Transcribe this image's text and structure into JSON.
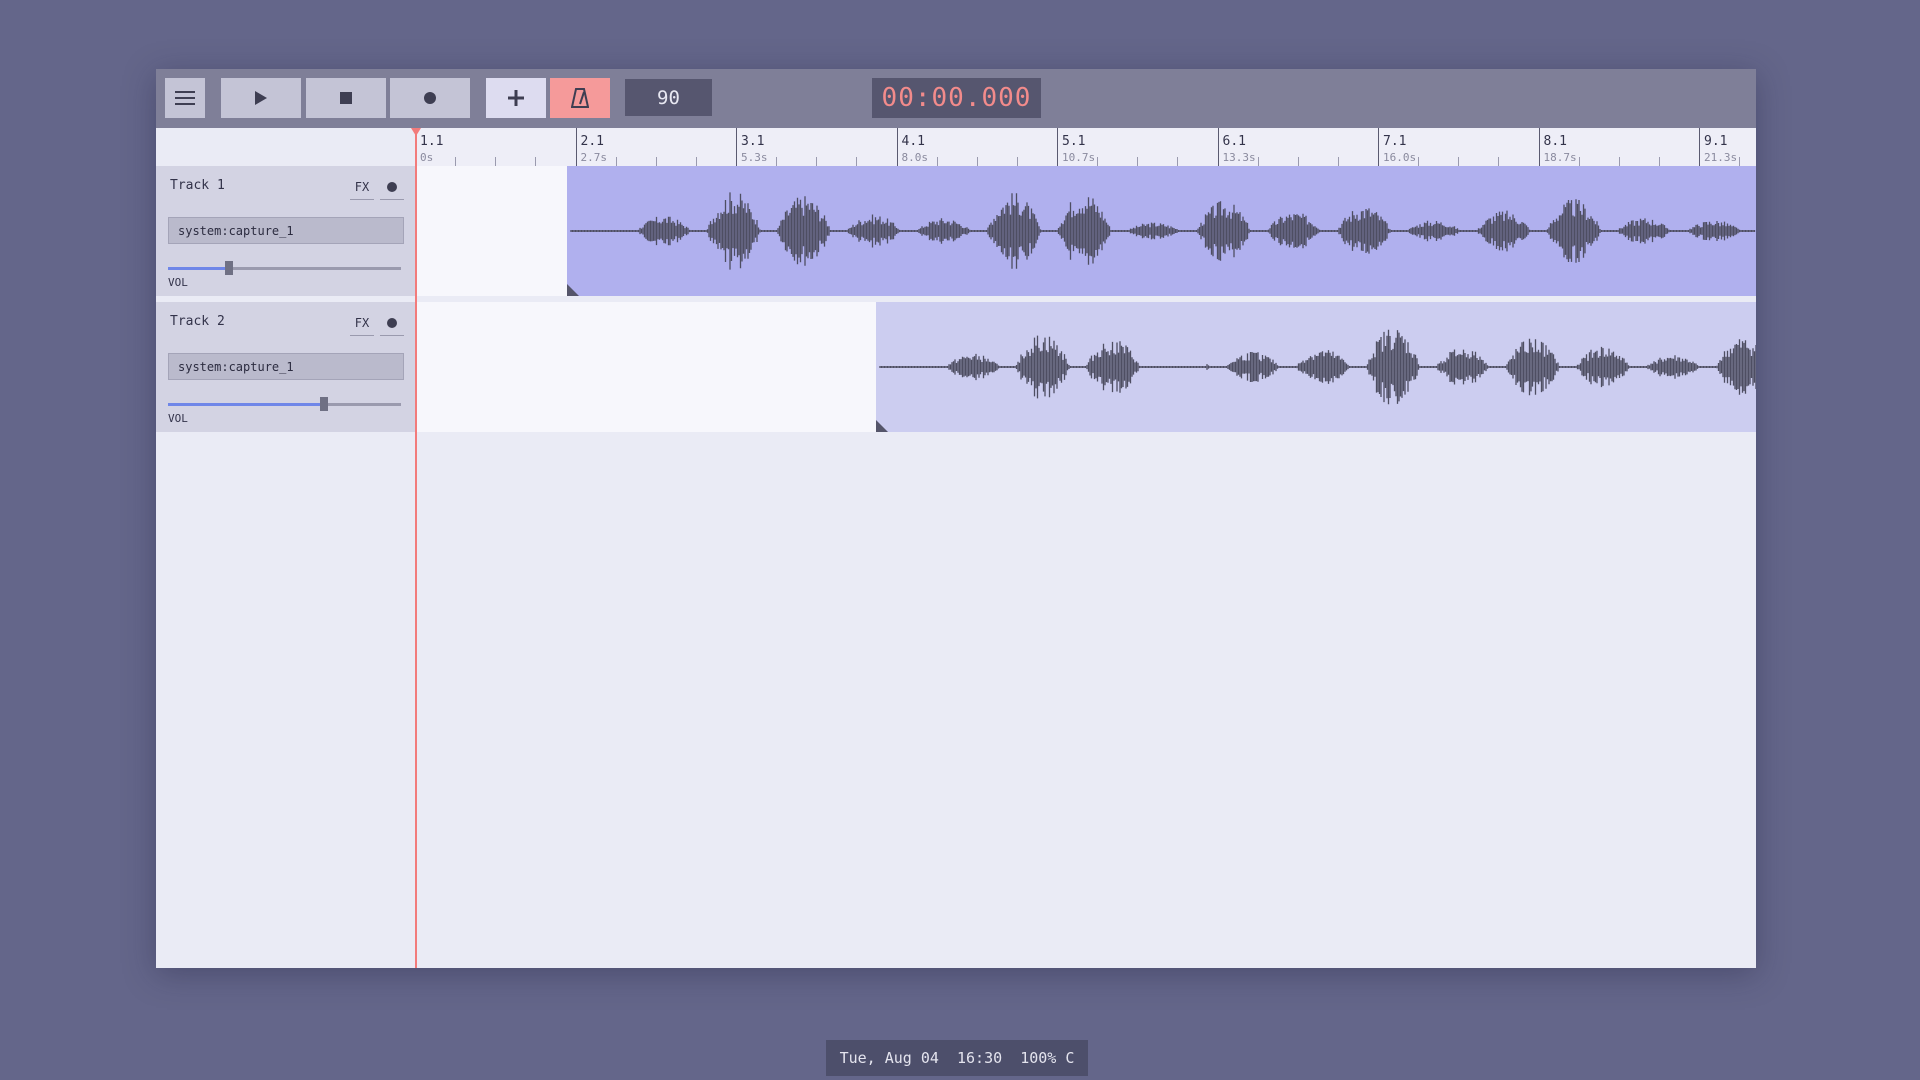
{
  "toolbar": {
    "menu_icon": "hamburger-menu-icon",
    "play_icon": "play-icon",
    "stop_icon": "stop-icon",
    "record_icon": "record-icon",
    "add_icon": "plus-icon",
    "metronome_icon": "metronome-icon",
    "tempo": "90",
    "clock": "00:00.000",
    "metronome_active_color": "#f59a9a",
    "add_button_color": "#dddcf0"
  },
  "ruler": {
    "bars": [
      {
        "bar": "1.1",
        "time": "0s"
      },
      {
        "bar": "2.1",
        "time": "2.7s"
      },
      {
        "bar": "3.1",
        "time": "5.3s"
      },
      {
        "bar": "4.1",
        "time": "8.0s"
      },
      {
        "bar": "5.1",
        "time": "10.7s"
      },
      {
        "bar": "6.1",
        "time": "13.3s"
      },
      {
        "bar": "7.1",
        "time": "16.0s"
      },
      {
        "bar": "8.1",
        "time": "18.7s"
      },
      {
        "bar": "9.1",
        "time": "21.3s"
      }
    ]
  },
  "tracks": [
    {
      "name": "Track 1",
      "fx_label": "FX",
      "input": "system:capture_1",
      "volume_label": "VOL",
      "volume": 0.26,
      "clip_start_bar": 1.95,
      "clip_color": "#b0b0ee"
    },
    {
      "name": "Track 2",
      "fx_label": "FX",
      "input": "system:capture_1",
      "volume_label": "VOL",
      "volume": 0.67,
      "clip_start_bar": 3.87,
      "clip_color": "#cccdf0"
    }
  ],
  "status": {
    "date": "Tue, Aug 04",
    "time": "16:30",
    "battery": "100% C"
  }
}
